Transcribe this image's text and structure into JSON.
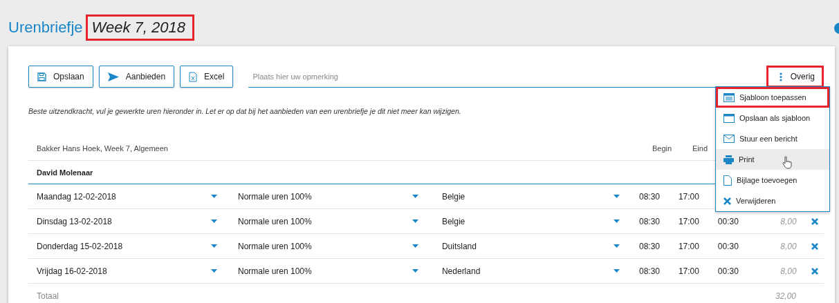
{
  "header": {
    "title": "Urenbriefje",
    "week": "Week 7, 2018",
    "week_highlighted": true
  },
  "toolbar": {
    "buttons": [
      "Opslaan",
      "Aanbieden",
      "Excel"
    ],
    "remark": {
      "placeholder": "Plaats hier uw opmerking"
    },
    "more": {
      "label": "Overig",
      "highlighted": true,
      "expanded": true
    }
  },
  "menu": [
    {
      "label": "Sjabloon toepassen",
      "highlighted": true,
      "hovered": false
    },
    {
      "label": "Opslaan als sjabloon",
      "highlighted": false,
      "hovered": false
    },
    {
      "label": "Stuur een bericht",
      "highlighted": false,
      "hovered": false
    },
    {
      "label": "Print",
      "highlighted": false,
      "hovered": true
    },
    {
      "label": "Bijlage toevoegen",
      "highlighted": false,
      "hovered": false
    },
    {
      "label": "Verwijderen",
      "highlighted": false,
      "hovered": false
    }
  ],
  "note": "Beste uitzendkracht, vul je gewerkte uren hieronder in. Let er op dat bij het aanbieden van een urenbriefje je dit niet meer kan wijzigen.",
  "table": {
    "caption": "Bakker Hans Hoek, Week 7, Algemeen",
    "columns": [
      "Begin",
      "Eind"
    ],
    "employee": "David Molenaar",
    "rows": [
      {
        "day": "Maandag 12-02-2018",
        "type": "Normale uren 100%",
        "country": "Belgie",
        "begin": "08:30",
        "end": "17:00"
      },
      {
        "day": "Dinsdag 13-02-2018",
        "type": "Normale uren 100%",
        "country": "Belgie",
        "begin": "08:30",
        "end": "17:00",
        "pause": "00:30",
        "hours": "8,00"
      },
      {
        "day": "Donderdag 15-02-2018",
        "type": "Normale uren 100%",
        "country": "Duitsland",
        "begin": "08:30",
        "end": "17:00",
        "pause": "00:30",
        "hours": "8,00"
      },
      {
        "day": "Vrijdag 16-02-2018",
        "type": "Normale uren 100%",
        "country": "Nederland",
        "begin": "08:30",
        "end": "17:00",
        "pause": "00:30",
        "hours": "8,00"
      }
    ],
    "total_label": "Totaal",
    "total": "32,00"
  }
}
